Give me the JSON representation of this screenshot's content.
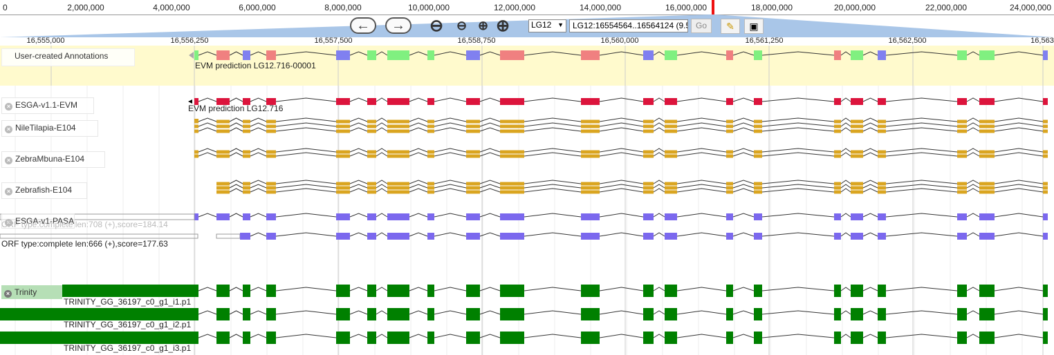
{
  "overview": {
    "labels": [
      "0",
      "2,000,000",
      "4,000,000",
      "6,000,000",
      "8,000,000",
      "10,000,000",
      "12,000,000",
      "14,000,000",
      "16,000,000",
      "18,000,000",
      "20,000,000",
      "22,000,000",
      "24,000,000"
    ]
  },
  "nav": {
    "back_icon": "arrow-left-icon",
    "forward_icon": "arrow-right-icon",
    "chrom_value": "LG12",
    "location_value": "LG12:16554564..16564124 (9.5",
    "go_label": "Go",
    "highlight_icon": "highlighter-icon",
    "screenshot_icon": "screen-capture-icon"
  },
  "ruler": {
    "labels": [
      "16,555,000",
      "16,556,250",
      "16,557,500",
      "16,558,750",
      "16,560,000",
      "16,561,250",
      "16,562,500",
      "16,563"
    ]
  },
  "tracks": {
    "user_annotations": {
      "label": "User-created Annotations",
      "feature": "EVM prediction LG12.716-00001",
      "color_a": "#f08080",
      "color_b": "#8080f0",
      "color_c": "#80f080"
    },
    "evm": {
      "label": "ESGA-v1.1-EVM",
      "feature": "EVM prediction LG12.716",
      "color": "#dc143c"
    },
    "nile": {
      "label": "NileTilapia-E104",
      "color": "#daa520"
    },
    "zebramb": {
      "label": "ZebraMbuna-E104",
      "color": "#daa520"
    },
    "zebrafish": {
      "label": "Zebrafish-E104",
      "color": "#daa520"
    },
    "pasa": {
      "label": "ESGA-v1-PASA",
      "feature1": "ORF type:complete len:708 (+),score=184.14",
      "feature2": "ORF type:complete len:666 (+),score=177.63",
      "color": "#7b68ee"
    },
    "trinity": {
      "label": "Trinity",
      "features": [
        "TRINITY_GG_36197_c0_g1_i1.p1",
        "TRINITY_GG_36197_c0_g1_i2.p1",
        "TRINITY_GG_36197_c0_g1_i3.p1"
      ],
      "color": "#008000"
    }
  }
}
